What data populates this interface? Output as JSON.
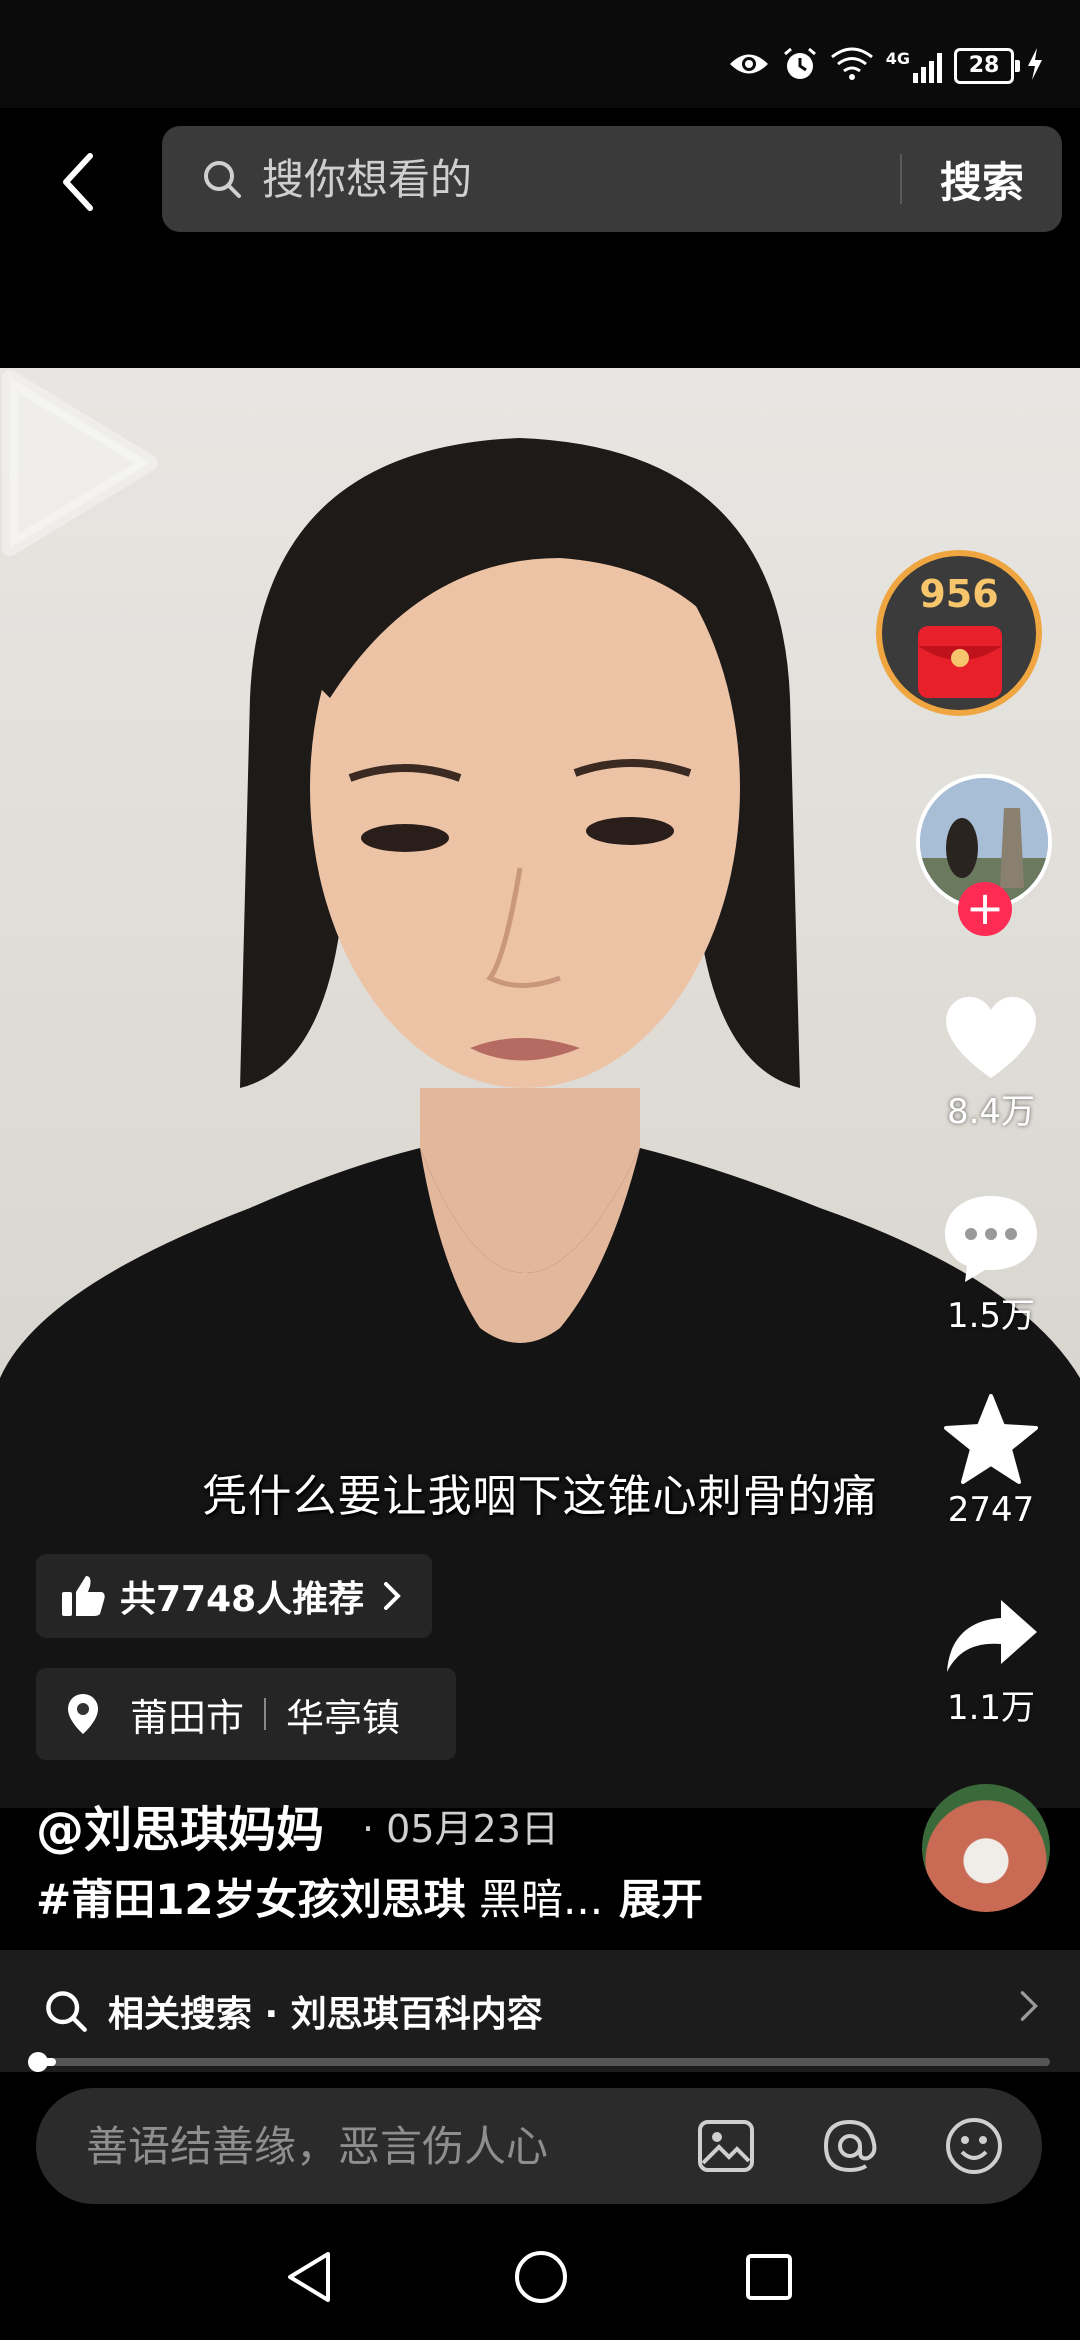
{
  "status_bar": {
    "network": "4G",
    "battery": "28"
  },
  "search": {
    "placeholder": "搜你想看的",
    "button_label": "搜索"
  },
  "video": {
    "subtitle": "凭什么要让我咽下这锥心刺骨的痛"
  },
  "rail": {
    "red_packet_count": "956",
    "likes": "8.4万",
    "comments": "1.5万",
    "favorites": "2747",
    "shares": "1.1万"
  },
  "recommend": {
    "label": "共7748人推荐"
  },
  "location": {
    "city": "莆田市",
    "town": "华亭镇"
  },
  "author": {
    "name": "@刘思琪妈妈",
    "date": "· 05月23日"
  },
  "caption": {
    "tag": "#莆田12岁女孩刘思琪",
    "text": " 黑暗...",
    "expand_label": "展开"
  },
  "related_search": {
    "label": "相关搜索 · 刘思琪百科内容"
  },
  "progress": {
    "fraction": 0.02
  },
  "comment": {
    "placeholder": "善语结善缘，恶言伤人心"
  },
  "colors": {
    "accent": "#fe2c55",
    "red_packet_ring": "#f0a640"
  }
}
